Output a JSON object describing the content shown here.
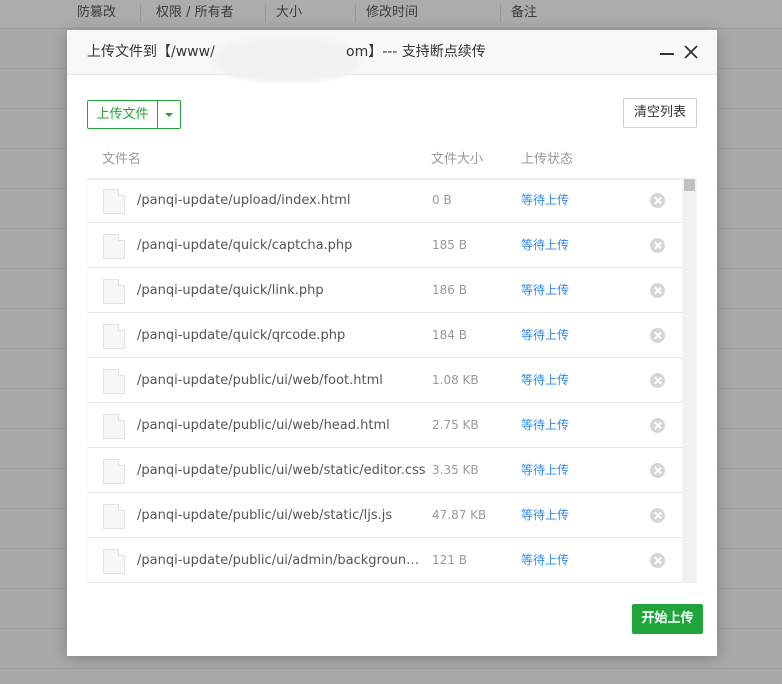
{
  "background_table": {
    "columns": [
      "防篡改",
      "权限 / 所有者",
      "大小",
      "修改时间",
      "备注"
    ]
  },
  "dialog": {
    "title_prefix": "上传文件到【/www/",
    "title_suffix": "om】--- 支持断点续传",
    "upload_button_label": "上传文件",
    "clear_button_label": "清空列表",
    "table_headers": {
      "name": "文件名",
      "size": "文件大小",
      "status": "上传状态"
    },
    "files": [
      {
        "name": "/panqi-update/upload/index.html",
        "size": "0 B",
        "status": "等待上传"
      },
      {
        "name": "/panqi-update/quick/captcha.php",
        "size": "185 B",
        "status": "等待上传"
      },
      {
        "name": "/panqi-update/quick/link.php",
        "size": "186 B",
        "status": "等待上传"
      },
      {
        "name": "/panqi-update/quick/qrcode.php",
        "size": "184 B",
        "status": "等待上传"
      },
      {
        "name": "/panqi-update/public/ui/web/foot.html",
        "size": "1.08 KB",
        "status": "等待上传"
      },
      {
        "name": "/panqi-update/public/ui/web/head.html",
        "size": "2.75 KB",
        "status": "等待上传"
      },
      {
        "name": "/panqi-update/public/ui/web/static/editor.css",
        "size": "3.35 KB",
        "status": "等待上传"
      },
      {
        "name": "/panqi-update/public/ui/web/static/ljs.js",
        "size": "47.87 KB",
        "status": "等待上传"
      },
      {
        "name": "/panqi-update/public/ui/admin/background-no...",
        "size": "121 B",
        "status": "等待上传"
      }
    ],
    "start_button_label": "开始上传"
  },
  "icons": {
    "minimize": "minimize-icon",
    "close": "close-icon",
    "file": "file-icon",
    "remove": "remove-circle-icon",
    "dropdown": "caret-down-icon"
  },
  "colors": {
    "accent_green": "#20a53a",
    "status_blue": "#2c8be8"
  }
}
